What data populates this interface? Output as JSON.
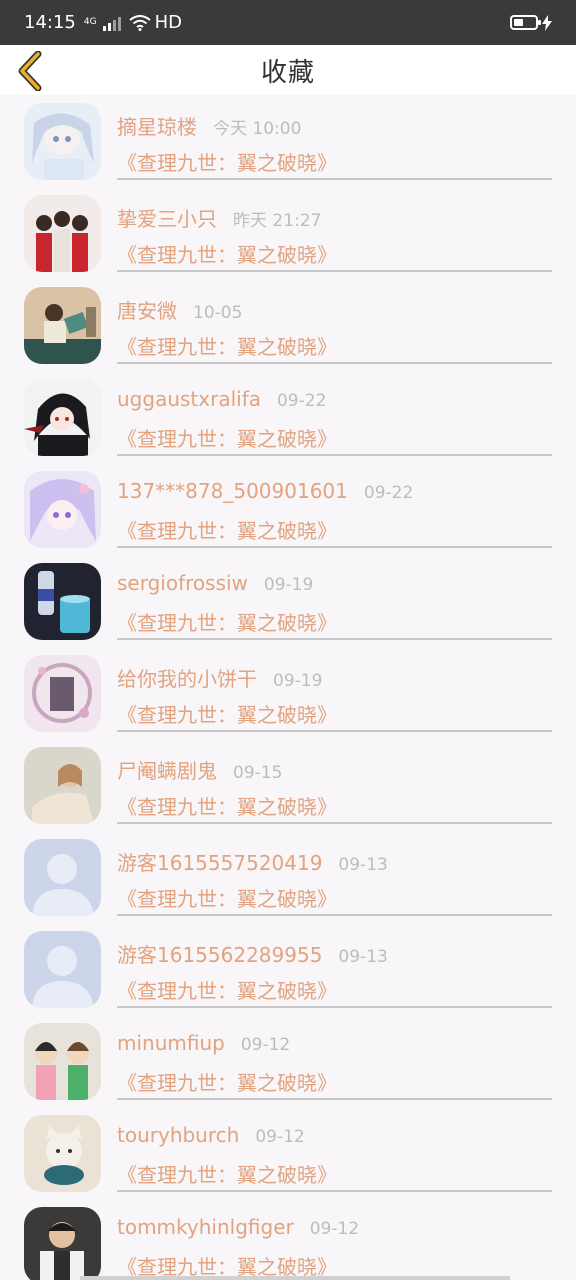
{
  "status_bar": {
    "time": "14:15",
    "network": "4G",
    "hd_label": "HD",
    "battery_level": 0.35,
    "charging_icon": "lightning-icon"
  },
  "header": {
    "title": "收藏",
    "back_icon": "chevron-left-icon",
    "accent_color": "#e9b226"
  },
  "colors": {
    "name": "#e2a37e",
    "time": "#bdbdbd",
    "divider": "#c8c8c8",
    "background": "#f8f6f8"
  },
  "items": [
    {
      "name": "摘星琼楼",
      "time": "今天 10:00",
      "book": "《查理九世：翼之破晓》",
      "avatar": "anime-girl-white-avatar"
    },
    {
      "name": "挚爱三小只",
      "time": "昨天 21:27",
      "book": "《查理九世：翼之破晓》",
      "avatar": "three-boys-avatar"
    },
    {
      "name": "唐安微",
      "time": "10-05",
      "book": "《查理九世：翼之破晓》",
      "avatar": "reading-girl-avatar"
    },
    {
      "name": "uggaustxralifa",
      "time": "09-22",
      "book": "《查理九世：翼之破晓》",
      "avatar": "dark-anime-avatar"
    },
    {
      "name": "137***878_500901601",
      "time": "09-22",
      "book": "《查理九世：翼之破晓》",
      "avatar": "anime-girl-purple-avatar"
    },
    {
      "name": "sergiofrossiw",
      "time": "09-19",
      "book": "《查理九世：翼之破晓》",
      "avatar": "bottle-glass-avatar"
    },
    {
      "name": "给你我的小饼干",
      "time": "09-19",
      "book": "《查理九世：翼之破晓》",
      "avatar": "pink-bubble-avatar"
    },
    {
      "name": "尸阉螨剧鬼",
      "time": "09-15",
      "book": "《查理九世：翼之破晓》",
      "avatar": "girl-leaning-avatar"
    },
    {
      "name": "游客1615557520419",
      "time": "09-13",
      "book": "《查理九世：翼之破晓》",
      "avatar": "default-user-avatar"
    },
    {
      "name": "游客1615562289955",
      "time": "09-13",
      "book": "《查理九世：翼之破晓》",
      "avatar": "default-user-avatar"
    },
    {
      "name": "minumfiup",
      "time": "09-12",
      "book": "《查理九世：翼之破晓》",
      "avatar": "cartoon-kids-avatar"
    },
    {
      "name": "touryhburch",
      "time": "09-12",
      "book": "《查理九世：翼之破晓》",
      "avatar": "cat-avatar"
    },
    {
      "name": "tommkyhinlgfiger",
      "time": "09-12",
      "book": "《查理九世：翼之破晓》",
      "avatar": "man-photo-avatar"
    }
  ]
}
